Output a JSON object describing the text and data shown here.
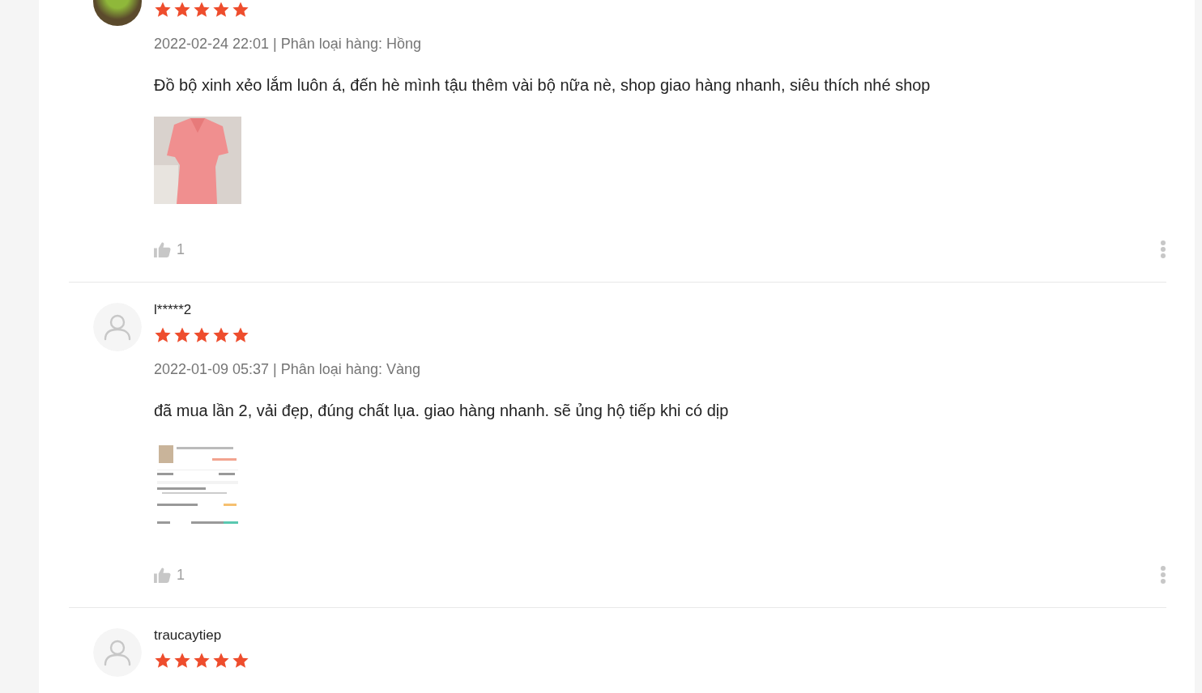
{
  "reviews": [
    {
      "avatar": {
        "kind": "photo"
      },
      "stars": 5,
      "meta": "2022-02-24 22:01 | Phân loại hàng: Hồng",
      "comment": "Đồ bộ xinh xẻo lắm luôn á, đến hè mình tậu thêm vài bộ nữa nè, shop giao hàng nhanh, siêu thích nhé shop",
      "photos": [
        {
          "kind": "clothing"
        }
      ],
      "likes": "1"
    },
    {
      "avatar": {
        "kind": "default"
      },
      "username": "l*****2",
      "stars": 5,
      "meta": "2022-01-09 05:37 | Phân loại hàng: Vàng",
      "comment": "đã mua lần 2, vải đẹp, đúng chất lụa. giao hàng nhanh. sẽ ủng hộ tiếp khi có dịp",
      "photos": [
        {
          "kind": "receipt"
        }
      ],
      "likes": "1"
    },
    {
      "avatar": {
        "kind": "default"
      },
      "username": "traucaytiep",
      "stars": 5
    }
  ]
}
